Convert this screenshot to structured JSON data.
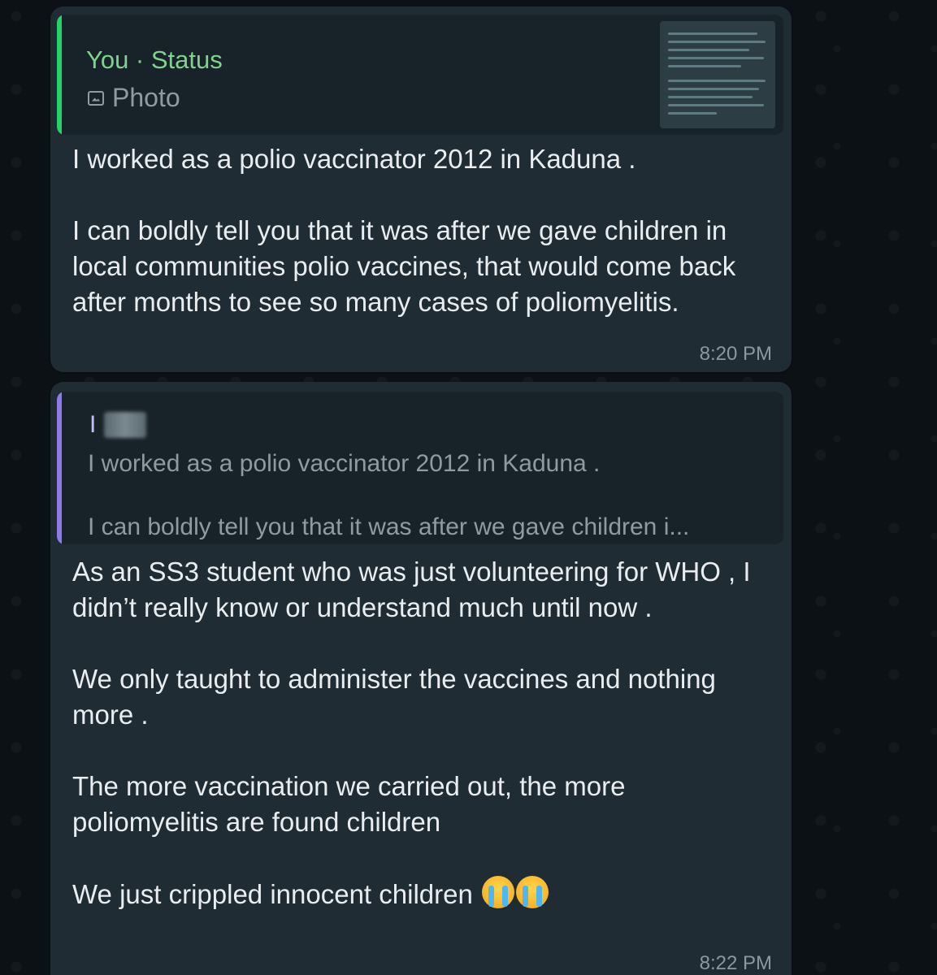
{
  "messages": [
    {
      "quote": {
        "author": "You · Status",
        "type_label": "Photo",
        "type_icon": "photo-icon",
        "bar_color": "#25d366"
      },
      "text": "I worked as a polio vaccinator 2012 in Kaduna .\n\nI can boldly tell you that it was after we gave children in local communities polio vaccines, that would come back after months to see so many cases of poliomyelitis.",
      "time": "8:20 PM"
    },
    {
      "quote": {
        "author": "I",
        "line1": "I worked as a polio vaccinator 2012 in Kaduna .",
        "line2": "I can boldly tell you that it was after we gave children i...",
        "bar_color": "#8d7be6"
      },
      "text": "As an SS3 student who was just volunteering for WHO , I didn’t really know or understand much until now .\n\nWe only taught to administer the vaccines and nothing more .\n\nThe more vaccination we carried out, the more poliomyelitis are found children\n\nWe just crippled innocent children",
      "emoji": [
        "loudly-crying-face",
        "loudly-crying-face"
      ],
      "time": "8:22 PM"
    }
  ]
}
